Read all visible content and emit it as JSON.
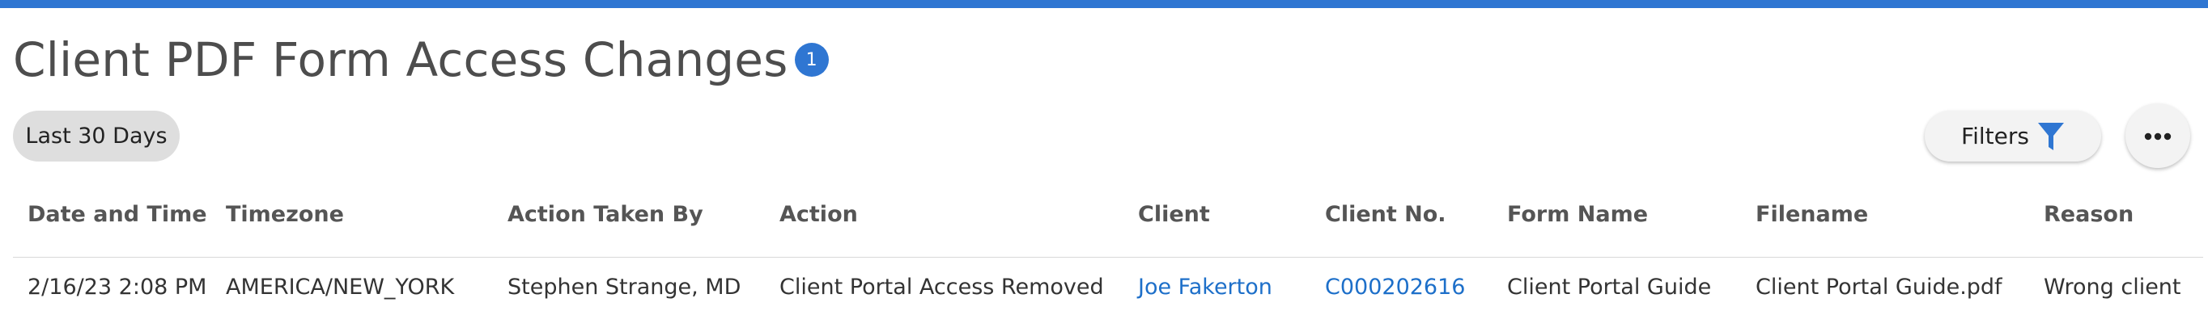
{
  "header": {
    "title": "Client PDF Form Access Changes",
    "badge_count": "1"
  },
  "toolbar": {
    "date_range_chip": "Last 30 Days",
    "filters_label": "Filters",
    "filter_icon": "funnel-icon",
    "more_icon": "more-horizontal-icon"
  },
  "table": {
    "columns": [
      "Date and Time",
      "Timezone",
      "Action Taken By",
      "Action",
      "Client",
      "Client No.",
      "Form Name",
      "Filename",
      "Reason"
    ],
    "rows": [
      {
        "date_time": "2/16/23 2:08 PM",
        "timezone": "AMERICA/NEW_YORK",
        "action_taken_by": "Stephen Strange, MD",
        "action": "Client Portal Access Removed",
        "client": "Joe Fakerton",
        "client_no": "C000202616",
        "form_name": "Client Portal Guide",
        "filename": "Client Portal Guide.pdf",
        "reason": "Wrong client"
      }
    ]
  },
  "colors": {
    "accent": "#2f76d2",
    "link": "#1d6fc9",
    "chip_bg": "#dedede"
  }
}
